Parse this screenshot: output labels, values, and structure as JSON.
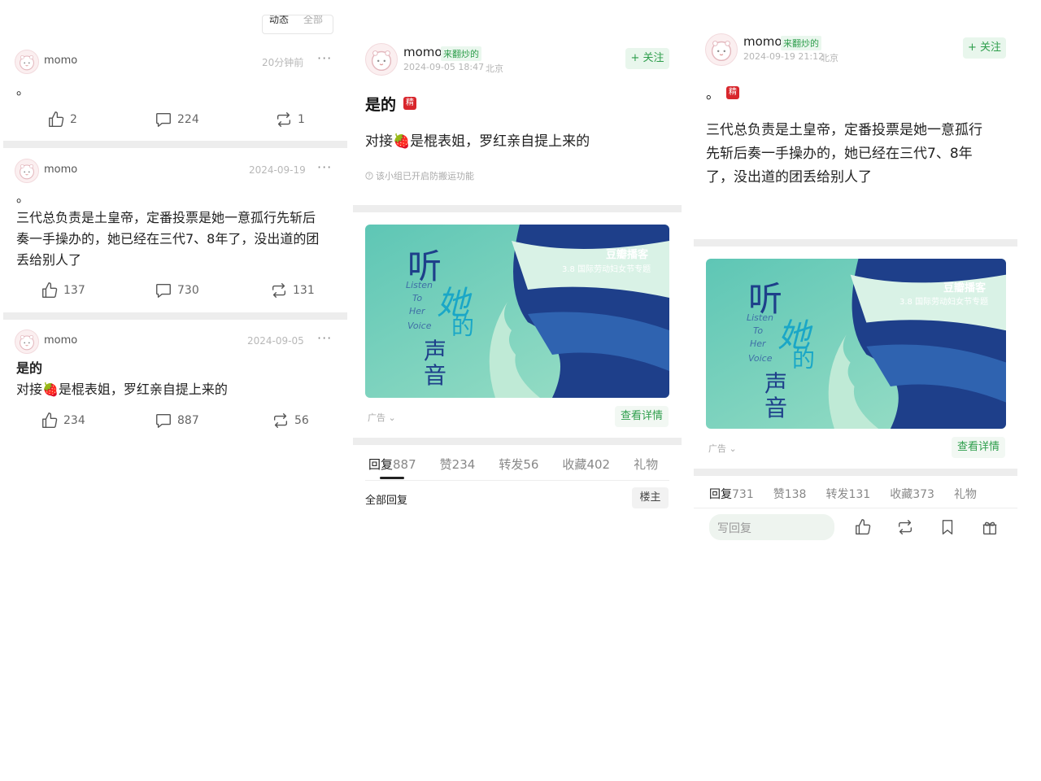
{
  "left": {
    "top_tabs": [
      "动态",
      "全部"
    ],
    "posts": [
      {
        "user": "momo",
        "time": "20分钟前",
        "more": "···",
        "line1": "。",
        "lines": [],
        "likes": "2",
        "comments": "224",
        "reposts": "1"
      },
      {
        "user": "momo",
        "time": "2024-09-19",
        "more": "···",
        "line1": "。",
        "lines": [
          "三代总负责是土皇帝，定番投票是她一意孤行先斩后",
          "奏一手操办的，她已经在三代7、8年了，没出道的团",
          "丢给别人了"
        ],
        "likes": "137",
        "comments": "730",
        "reposts": "131"
      },
      {
        "user": "momo",
        "time": "2024-09-05",
        "more": "···",
        "title": "是的",
        "lines": [
          "对接🍓是棍表姐，罗红亲自提上来的"
        ],
        "likes": "234",
        "comments": "887",
        "reposts": "56"
      }
    ]
  },
  "middle": {
    "user": "momo",
    "badge": "来翻炒的",
    "time": "2024-09-05 18:47",
    "location": "北京",
    "follow": "+ 关注",
    "title": "是的",
    "jing": "精",
    "body": "对接🍓是棍表姐，罗红亲自提上来的",
    "notice": "该小组已开启防搬运功能",
    "banner": {
      "brand": "豆瓣播客",
      "subtitle": "3.8 国际劳动妇女节专题",
      "ting": "听",
      "ta": "她",
      "de": "的",
      "sheng": "声",
      "yin": "音",
      "en": [
        "Listen",
        "To",
        "Her",
        "Voice"
      ]
    },
    "ad": "广告",
    "detail": "查看详情",
    "tabs": [
      {
        "label": "回复",
        "count": "887"
      },
      {
        "label": "赞",
        "count": "234"
      },
      {
        "label": "转发",
        "count": "56"
      },
      {
        "label": "收藏",
        "count": "402"
      },
      {
        "label": "礼物",
        "count": ""
      }
    ],
    "all_replies": "全部回复",
    "louzhu": "楼主"
  },
  "right": {
    "user": "momo",
    "badge": "来翻炒的",
    "time": "2024-09-19 21:12",
    "location": "北京",
    "follow": "+ 关注",
    "line1": "。",
    "jing": "精",
    "lines": [
      "三代总负责是土皇帝，定番投票是她一意孤行",
      "先斩后奏一手操办的，她已经在三代7、8年",
      "了，没出道的团丢给别人了"
    ],
    "banner": {
      "brand": "豆瓣播客",
      "subtitle": "3.8 国际劳动妇女节专题",
      "ting": "听",
      "ta": "她",
      "de": "的",
      "sheng": "声",
      "yin": "音",
      "en": [
        "Listen",
        "To",
        "Her",
        "Voice"
      ]
    },
    "ad": "广告",
    "detail": "查看详情",
    "tabs": [
      {
        "label": "回复",
        "count": "731"
      },
      {
        "label": "赞",
        "count": "138"
      },
      {
        "label": "转发",
        "count": "131"
      },
      {
        "label": "收藏",
        "count": "373"
      },
      {
        "label": "礼物",
        "count": ""
      }
    ],
    "reply_placeholder": "写回复"
  }
}
